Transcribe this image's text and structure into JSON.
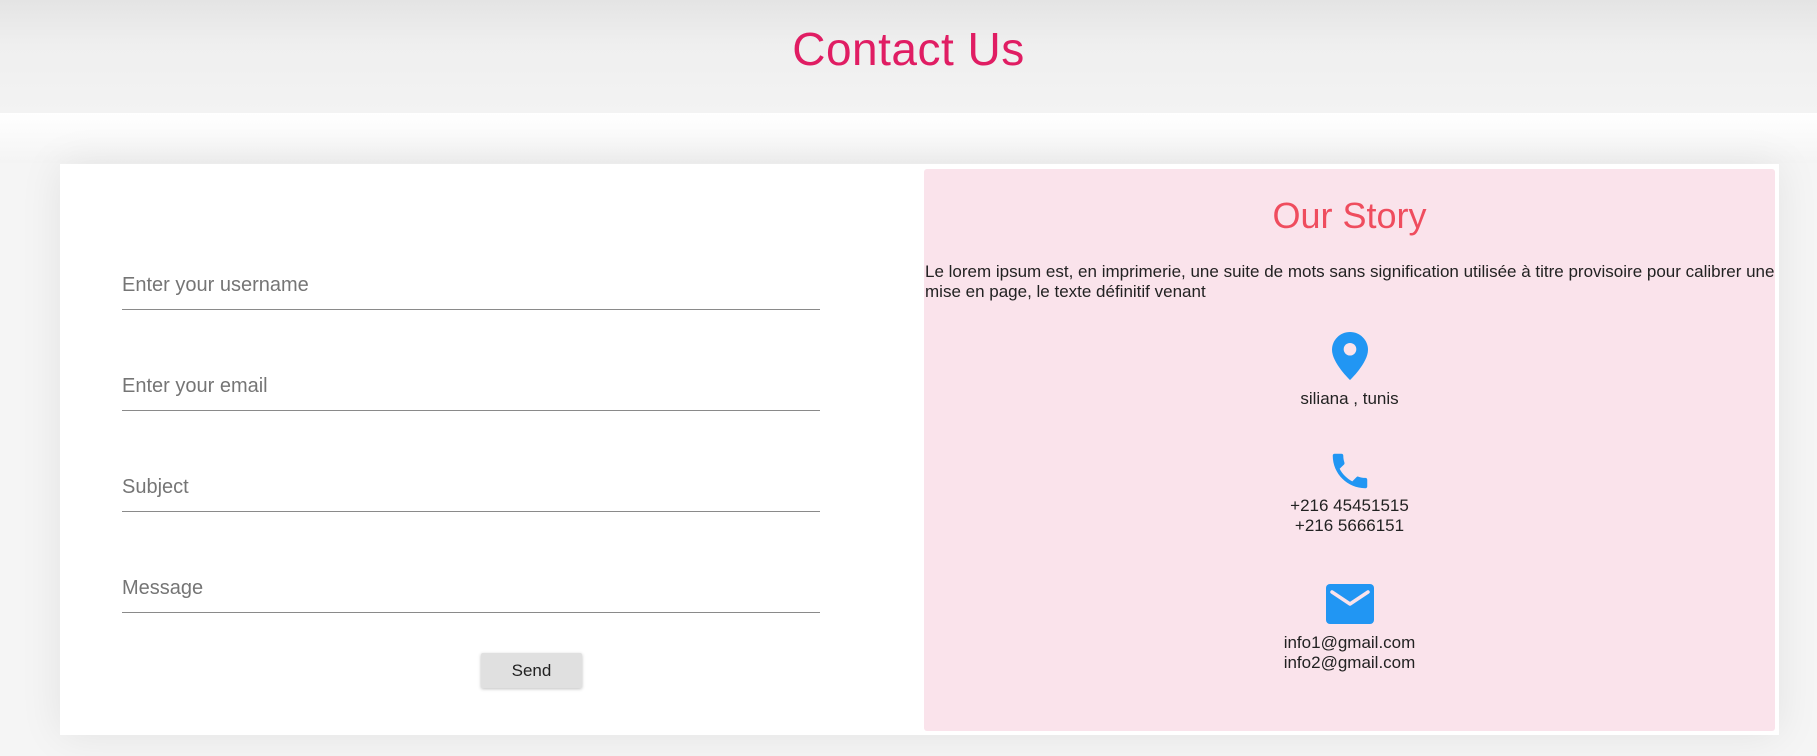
{
  "header": {
    "title": "Contact Us"
  },
  "form": {
    "username_placeholder": "Enter your username",
    "email_placeholder": "Enter your email",
    "subject_placeholder": "Subject",
    "message_placeholder": "Message",
    "send_label": "Send"
  },
  "story": {
    "title": "Our Story",
    "description": "Le lorem ipsum est, en imprimerie, une suite de mots sans signification utilisée à titre provisoire pour calibrer une mise en page, le texte définitif venant",
    "location": {
      "icon": "map-pin-icon",
      "text": "siliana , tunis"
    },
    "phone": {
      "icon": "phone-icon",
      "lines": [
        "+216 45451515",
        "+216 5666151"
      ]
    },
    "email": {
      "icon": "envelope-icon",
      "lines": [
        "info1@gmail.com",
        "info2@gmail.com"
      ]
    }
  },
  "colors": {
    "title": "#e01d63",
    "story_title": "#ef4d5e",
    "story_bg": "#fae3eb",
    "icon": "#2196f3"
  }
}
